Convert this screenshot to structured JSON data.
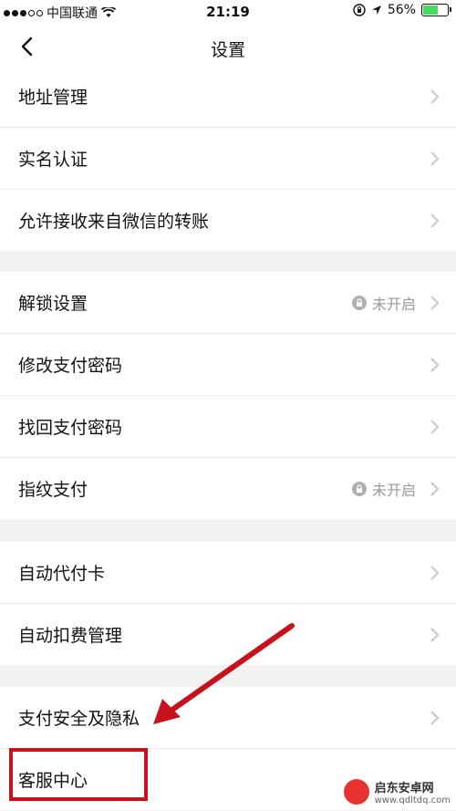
{
  "status_bar": {
    "carrier": "中国联通",
    "time": "21:19",
    "battery_percent": "56%",
    "battery_level": 0.56
  },
  "nav": {
    "title": "设置"
  },
  "groups": [
    {
      "rows": [
        {
          "label": "地址管理"
        },
        {
          "label": "实名认证"
        },
        {
          "label": "允许接收来自微信的转账"
        }
      ]
    },
    {
      "rows": [
        {
          "label": "解锁设置",
          "status": "未开启"
        },
        {
          "label": "修改支付密码"
        },
        {
          "label": "找回支付密码"
        },
        {
          "label": "指纹支付",
          "status": "未开启"
        }
      ]
    },
    {
      "rows": [
        {
          "label": "自动代付卡"
        },
        {
          "label": "自动扣费管理"
        }
      ]
    },
    {
      "rows": [
        {
          "label": "支付安全及隐私"
        },
        {
          "label": "客服中心"
        }
      ]
    }
  ],
  "watermark": {
    "name": "启东安卓网",
    "url": "www.qdltdq.com"
  },
  "colors": {
    "annotation": "#c8121b",
    "separator_bg": "#f2f2f2",
    "battery": "#4cd964"
  }
}
